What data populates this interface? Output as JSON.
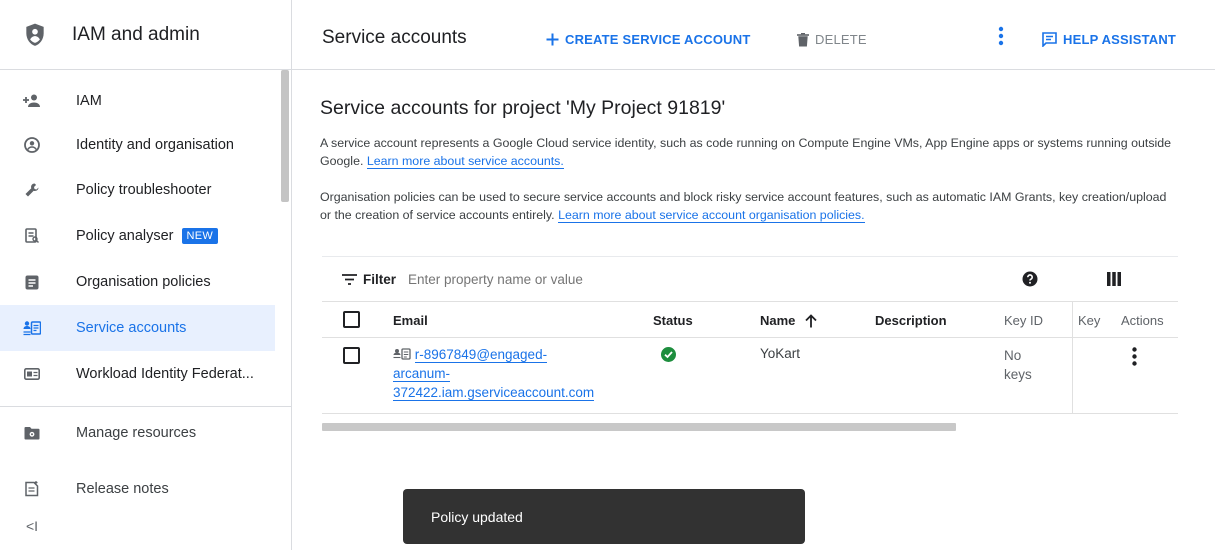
{
  "app": {
    "title": "IAM and admin",
    "icon": "iam-shield-icon"
  },
  "sidebar": {
    "items": [
      {
        "label": "IAM",
        "icon": "person-add-icon"
      },
      {
        "label": "Identity and organisation",
        "icon": "account-circle-icon"
      },
      {
        "label": "Policy troubleshooter",
        "icon": "wrench-icon"
      },
      {
        "label": "Policy analyser",
        "icon": "document-search-icon",
        "badge": "NEW"
      },
      {
        "label": "Organisation policies",
        "icon": "list-document-icon"
      },
      {
        "label": "Service accounts",
        "icon": "service-account-icon",
        "active": true
      },
      {
        "label": "Workload Identity Federat...",
        "icon": "id-card-icon"
      },
      {
        "label": "Manage resources",
        "icon": "folder-gear-icon"
      },
      {
        "label": "Release notes",
        "icon": "notes-icon"
      }
    ],
    "collapse_label": "<I"
  },
  "toolbar": {
    "title": "Service accounts",
    "create_label": "CREATE SERVICE ACCOUNT",
    "delete_label": "DELETE",
    "help_label": "HELP ASSISTANT"
  },
  "main": {
    "heading": "Service accounts for project 'My Project 91819'",
    "p1_text": "A service account represents a Google Cloud service identity, such as code running on Compute Engine VMs, App Engine apps or systems running outside Google. ",
    "p1_link": "Learn more about service accounts.",
    "p2_text": "Organisation policies can be used to secure service accounts and block risky service account features, such as automatic IAM Grants, key creation/upload or the creation of service accounts entirely. ",
    "p2_link": "Learn more about service account organisation policies."
  },
  "filter": {
    "label": "Filter",
    "placeholder": "Enter property name or value"
  },
  "table": {
    "headers": {
      "email": "Email",
      "status": "Status",
      "name": "Name",
      "description": "Description",
      "key_id": "Key ID",
      "key": "Key",
      "actions": "Actions"
    },
    "rows": [
      {
        "email_line1": "r-8967849@engaged-",
        "email_line2": "arcanum-",
        "email_line3": "372422.iam.gserviceaccount.com",
        "status": "enabled",
        "name": "YoKart",
        "description": "",
        "key_id_line1": "No",
        "key_id_line2": "keys"
      }
    ]
  },
  "snackbar": {
    "message": "Policy updated"
  },
  "colors": {
    "accent": "#1a73e8",
    "active_bg": "#e8f0fe",
    "status_ok": "#1e8e3e",
    "snackbar_bg": "#323232"
  }
}
